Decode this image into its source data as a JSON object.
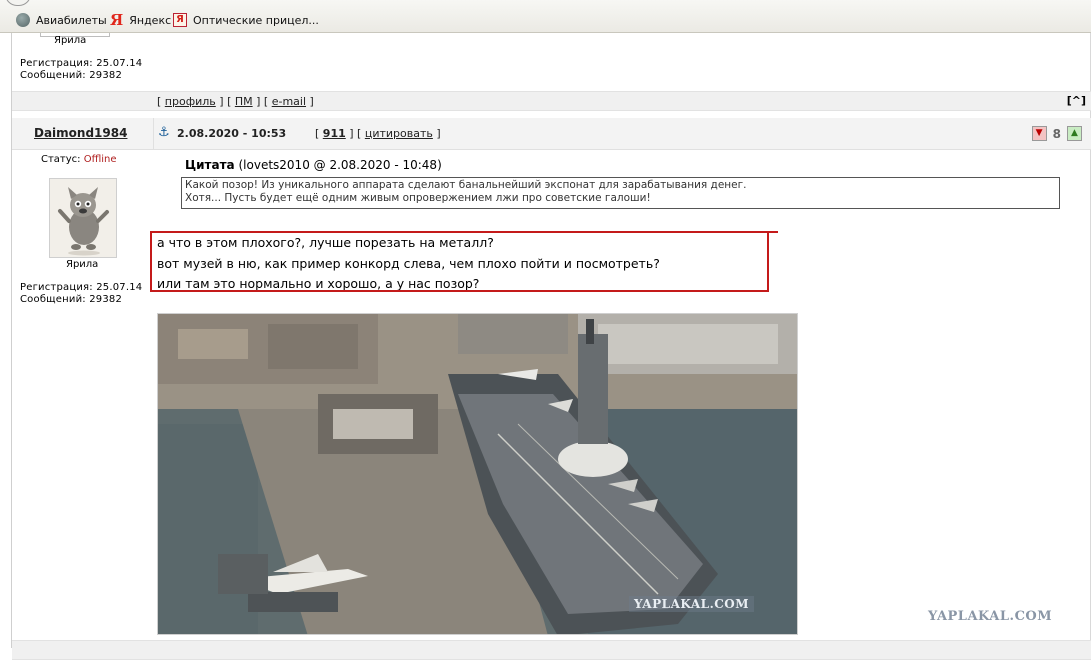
{
  "bookmarks": {
    "items": [
      {
        "label": "Авиабилеты",
        "icon": "globe-icon"
      },
      {
        "label": "Яндекс",
        "icon": "yandex-icon"
      },
      {
        "label": "Оптические прицел...",
        "icon": "yandex-square-icon"
      }
    ]
  },
  "prev_post": {
    "username": "Ярила",
    "registration": "Регистрация: 25.07.14",
    "messages": "Сообщений: 29382"
  },
  "post_links": {
    "open": "[ ",
    "profile": "профиль",
    "mid1": " ] [ ",
    "pm": "ПМ",
    "mid2": " ] [ ",
    "email": "e-mail",
    "close": " ]",
    "top": "[^]"
  },
  "post": {
    "author": "Daimond1984",
    "anchor_icon": "anchor-icon",
    "date": "2.08.2020 - 10:53",
    "bracket_open": "[ ",
    "number": "911",
    "bracket_mid": " ] [ ",
    "quote_link": "цитировать",
    "bracket_close": " ]",
    "rating": "8",
    "rate_down_icon": "thumb-down-icon",
    "rate_up_icon": "thumb-up-icon",
    "status_label": "Статус: ",
    "status_value": "Offline",
    "status_color": "#b02020",
    "user_title": "Ярила",
    "registration": "Регистрация: 25.07.14",
    "messages": "Сообщений: 29382",
    "quote_title": "Цитата",
    "quote_meta": "(lovets2010 @ 2.08.2020 - 10:48)",
    "quote_lines": [
      "Какой позор! Из уникального аппарата сделают банальнейший экспонат для зарабатывания денег.",
      "Хотя... Пусть будет ещё одним живым опровержением лжи про советские галоши!"
    ],
    "text_lines": [
      "а что в этом плохого?, лучше порезать на металл?",
      "вот музей в ню, как пример конкорд слева, чем плохо пойти и посмотреть?",
      "или там это нормально и хорошо, а у нас позор?"
    ],
    "highlight_color": "#c41a1a",
    "photo_watermark": "YAPLAKAL.COM"
  },
  "page_watermark": "YAPLAKAL.COM",
  "colors": {
    "post_number": "#c00000",
    "bar_bg": "#f0f0f0"
  }
}
